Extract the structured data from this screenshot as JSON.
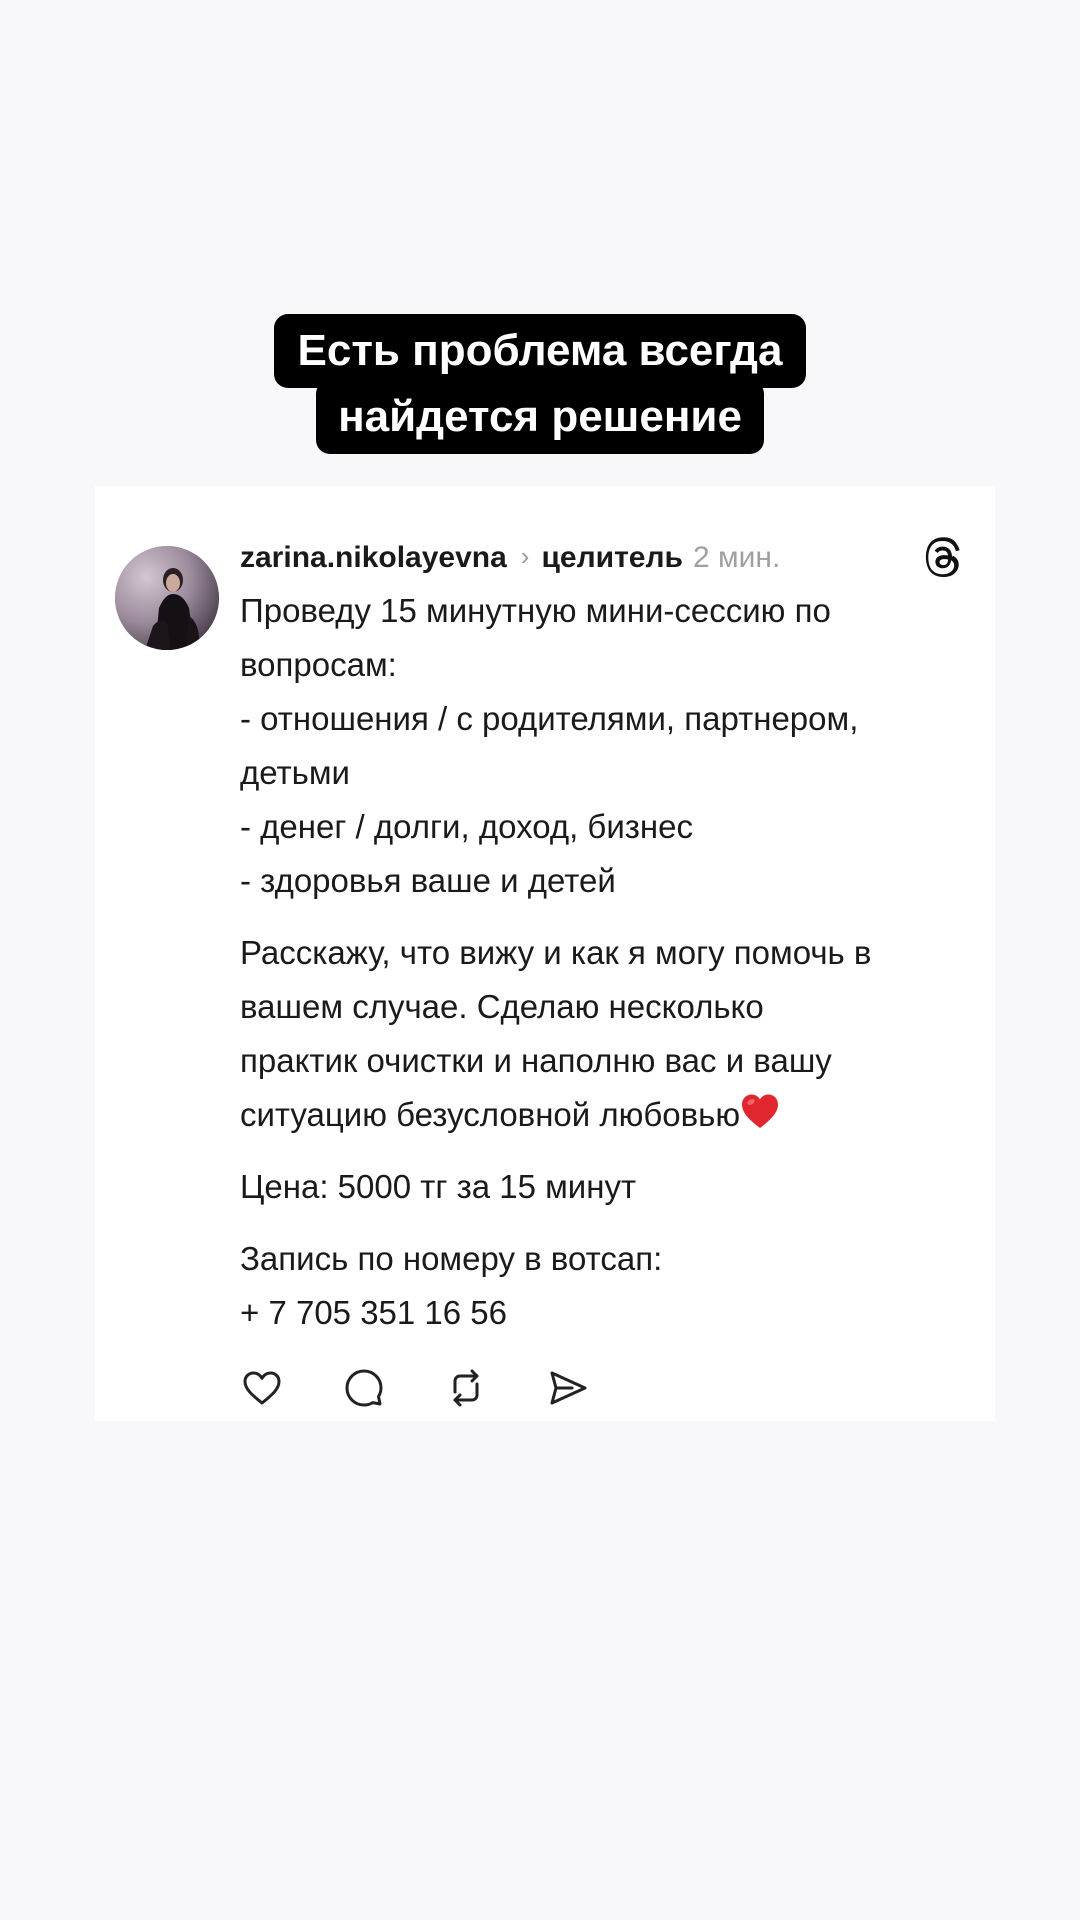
{
  "headline": {
    "line1": "Есть проблема всегда",
    "line2": "найдется решение"
  },
  "post": {
    "username": "zarina.nikolayevna",
    "separator_icon": "chevron-right-icon",
    "topic": "целитель",
    "time": "2 мин.",
    "app_logo": "threads-logo-icon",
    "text": {
      "line1": "Проведу 15 минутную мини-сессию по",
      "line2": "вопросам:",
      "line3": "- отношения / с родителями, партнером,",
      "line4": "детьми",
      "line5": "- денег / долги, доход, бизнес",
      "line6": "- здоровья ваше и детей",
      "para2_line1": "Расскажу, что вижу и как я могу помочь в",
      "para2_line2": "вашем случае. Сделаю несколько",
      "para2_line3": "практик очистки и наполню вас и вашу",
      "para2_line4": "ситуацию безусловной любовью",
      "price": "Цена: 5000 тг за 15 минут",
      "contact_line1": "Запись по номеру в вотсап:",
      "contact_line2": "+ 7 705 351 16 56"
    },
    "actions": [
      "like-icon",
      "comment-icon",
      "repost-icon",
      "share-icon"
    ]
  },
  "colors": {
    "background": "#f8f8fa",
    "card": "#ffffff",
    "text": "#1a1a1a",
    "muted": "#a0a0a0",
    "heart": "#e0262e"
  }
}
